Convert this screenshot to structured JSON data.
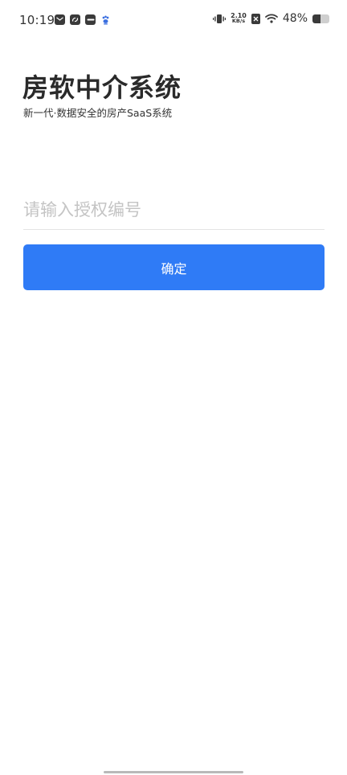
{
  "status_bar": {
    "time": "10:19",
    "net_speed_value": "2.10",
    "net_speed_unit": "KB/s",
    "battery_percent_text": "48%",
    "battery_level": 0.48,
    "icons": [
      "mail-icon",
      "link-icon",
      "vivo-icon",
      "paw-icon",
      "vibrate-icon",
      "no-sim-icon",
      "wifi-icon",
      "battery-icon"
    ]
  },
  "header": {
    "title": "房软中介系统",
    "subtitle": "新一代·数据安全的房产SaaS系统"
  },
  "form": {
    "auth_code_placeholder": "请输入授权编号",
    "auth_code_value": "",
    "confirm_label": "确定"
  },
  "colors": {
    "primary": "#2f7bf6",
    "title_text": "#2a2a2a",
    "placeholder": "#c4c4c4",
    "divider": "#e4e4e4"
  }
}
